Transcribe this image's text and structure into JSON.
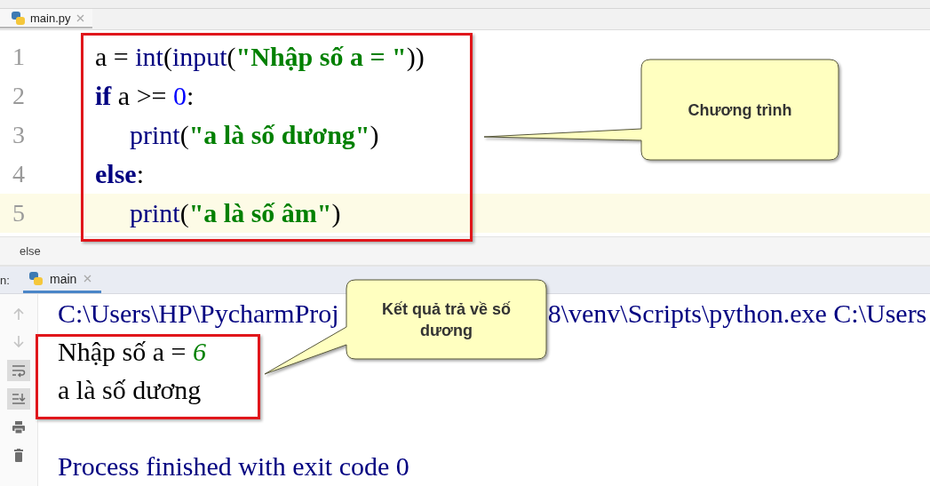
{
  "editor_tabs": [
    {
      "label": "main.py",
      "selected": true
    }
  ],
  "code_lines": [
    {
      "number": "1",
      "indent": false,
      "current": false,
      "tokens": [
        {
          "text": "a = ",
          "kind": "plain"
        },
        {
          "text": "int",
          "kind": "builtin"
        },
        {
          "text": "(",
          "kind": "plain"
        },
        {
          "text": "input",
          "kind": "builtin"
        },
        {
          "text": "(",
          "kind": "plain"
        },
        {
          "text": "\"Nhập số a = \"",
          "kind": "string"
        },
        {
          "text": "))",
          "kind": "plain"
        }
      ]
    },
    {
      "number": "2",
      "indent": false,
      "current": false,
      "tokens": [
        {
          "text": "if",
          "kind": "keyword"
        },
        {
          "text": " a >= ",
          "kind": "plain"
        },
        {
          "text": "0",
          "kind": "number"
        },
        {
          "text": ":",
          "kind": "plain"
        }
      ]
    },
    {
      "number": "3",
      "indent": true,
      "current": false,
      "tokens": [
        {
          "text": "print",
          "kind": "builtin"
        },
        {
          "text": "(",
          "kind": "plain"
        },
        {
          "text": "\"a là số dương\"",
          "kind": "string"
        },
        {
          "text": ")",
          "kind": "plain"
        }
      ]
    },
    {
      "number": "4",
      "indent": false,
      "current": false,
      "tokens": [
        {
          "text": "else",
          "kind": "keyword"
        },
        {
          "text": ":",
          "kind": "plain"
        }
      ]
    },
    {
      "number": "5",
      "indent": true,
      "current": true,
      "tokens": [
        {
          "text": "print",
          "kind": "builtin"
        },
        {
          "text": "(",
          "kind": "plain"
        },
        {
          "text": "\"a là số âm\"",
          "kind": "string"
        },
        {
          "text": ")",
          "kind": "plain"
        }
      ]
    }
  ],
  "breadcrumb": "else",
  "run_panel": {
    "label": "n:",
    "tabs": [
      {
        "label": "main",
        "selected": true
      }
    ]
  },
  "console_toolbar": [
    {
      "kind": "up",
      "on": false,
      "disabled": true
    },
    {
      "kind": "down",
      "on": false,
      "disabled": true
    },
    {
      "kind": "wrap",
      "on": true,
      "disabled": false
    },
    {
      "kind": "scroll-end",
      "on": true,
      "disabled": false
    },
    {
      "kind": "print",
      "on": false,
      "disabled": false
    },
    {
      "kind": "trash",
      "on": false,
      "disabled": false
    }
  ],
  "console_lines": [
    {
      "kind": "command",
      "parts": [
        "C:\\Users\\HP\\PycharmProj",
        "8\\venv\\Scripts\\python.exe C:\\Users"
      ]
    },
    {
      "kind": "prompt",
      "text": "Nhập số a = ",
      "input": "6"
    },
    {
      "kind": "output",
      "text": "a là số dương"
    },
    {
      "kind": "exit",
      "text": "Process finished with exit code 0"
    }
  ],
  "callouts": [
    {
      "text": "Chương trình"
    },
    {
      "text": "Kết quả trả về số dương"
    }
  ]
}
